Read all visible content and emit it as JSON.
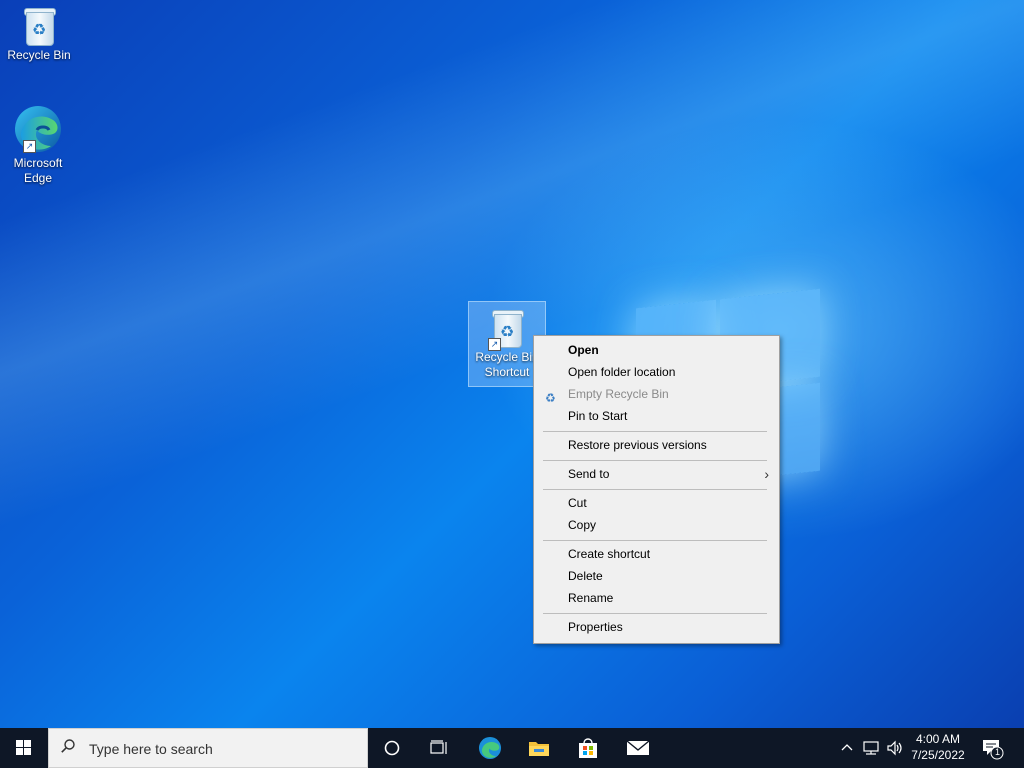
{
  "desktop": {
    "icons": [
      {
        "label": "Recycle Bin"
      },
      {
        "label_line1": "Microsoft",
        "label_line2": "Edge"
      },
      {
        "label_line1": "Recycle Bin",
        "label_line2": "Shortcut"
      }
    ]
  },
  "context_menu": {
    "items": [
      {
        "label": "Open"
      },
      {
        "label": "Open folder location"
      },
      {
        "label": "Empty Recycle Bin",
        "disabled": true
      },
      {
        "label": "Pin to Start"
      },
      {
        "label": "Restore previous versions"
      },
      {
        "label": "Send to"
      },
      {
        "label": "Cut"
      },
      {
        "label": "Copy"
      },
      {
        "label": "Create shortcut"
      },
      {
        "label": "Delete"
      },
      {
        "label": "Rename"
      },
      {
        "label": "Properties"
      }
    ]
  },
  "taskbar": {
    "search_placeholder": "Type here to search",
    "clock_time": "4:00 AM",
    "clock_date": "7/25/2022",
    "notification_count": "1"
  },
  "colors": {
    "accent": "#0a62d8",
    "taskbar": "#0e1726",
    "menu_bg": "#f0f0f0"
  }
}
